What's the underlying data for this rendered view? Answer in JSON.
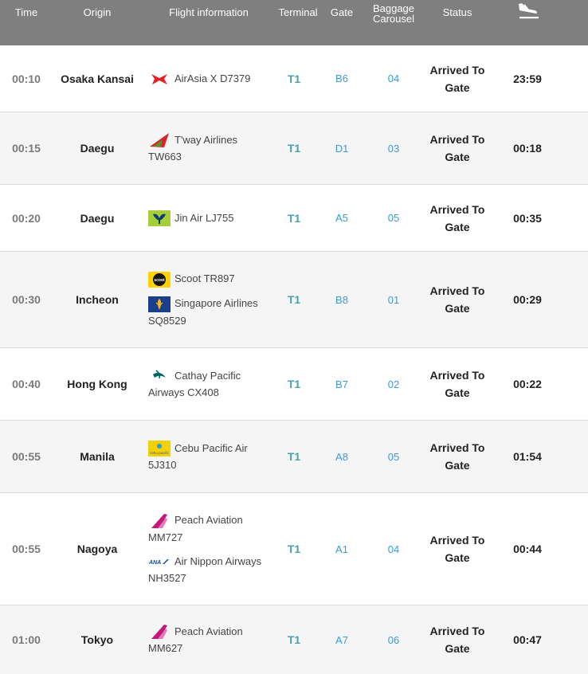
{
  "header": {
    "time": "Time",
    "origin": "Origin",
    "flight_info": "Flight information",
    "terminal": "Terminal",
    "gate": "Gate",
    "baggage_line1": "Baggage",
    "baggage_line2": "Carousel",
    "status": "Status",
    "arrival_icon": "plane-landing-icon"
  },
  "rows": [
    {
      "time": "00:10",
      "origin": "Osaka Kansai",
      "flights": [
        {
          "logo": "airasia-logo",
          "line1": "AirAsia X D7379",
          "line2": ""
        }
      ],
      "terminal": "T1",
      "gate": "B6",
      "carousel": "04",
      "status_line1": "Arrived To",
      "status_line2": "Gate",
      "actual": "23:59"
    },
    {
      "time": "00:15",
      "origin": "Daegu",
      "flights": [
        {
          "logo": "tway-logo",
          "line1": "T'way Airlines",
          "line2": "TW663"
        }
      ],
      "terminal": "T1",
      "gate": "D1",
      "carousel": "03",
      "status_line1": "Arrived To",
      "status_line2": "Gate",
      "actual": "00:18"
    },
    {
      "time": "00:20",
      "origin": "Daegu",
      "flights": [
        {
          "logo": "jinair-logo",
          "line1": "Jin Air LJ755",
          "line2": ""
        }
      ],
      "terminal": "T1",
      "gate": "A5",
      "carousel": "05",
      "status_line1": "Arrived To",
      "status_line2": "Gate",
      "actual": "00:35"
    },
    {
      "time": "00:30",
      "origin": "Incheon",
      "flights": [
        {
          "logo": "scoot-logo",
          "line1": "Scoot TR897",
          "line2": ""
        },
        {
          "logo": "singapore-airlines-logo",
          "line1": "Singapore Airlines",
          "line2": "SQ8529"
        }
      ],
      "terminal": "T1",
      "gate": "B8",
      "carousel": "01",
      "status_line1": "Arrived To",
      "status_line2": "Gate",
      "actual": "00:29"
    },
    {
      "time": "00:40",
      "origin": "Hong Kong",
      "flights": [
        {
          "logo": "cathay-pacific-logo",
          "line1": "Cathay Pacific",
          "line2": "Airways CX408"
        }
      ],
      "terminal": "T1",
      "gate": "B7",
      "carousel": "02",
      "status_line1": "Arrived To",
      "status_line2": "Gate",
      "actual": "00:22"
    },
    {
      "time": "00:55",
      "origin": "Manila",
      "flights": [
        {
          "logo": "cebu-pacific-logo",
          "line1": "Cebu Pacific Air",
          "line2": "5J310"
        }
      ],
      "terminal": "T1",
      "gate": "A8",
      "carousel": "05",
      "status_line1": "Arrived To",
      "status_line2": "Gate",
      "actual": "01:54"
    },
    {
      "time": "00:55",
      "origin": "Nagoya",
      "flights": [
        {
          "logo": "peach-logo",
          "line1": "Peach Aviation",
          "line2": "MM727"
        },
        {
          "logo": "ana-logo",
          "line1": "Air Nippon Airways",
          "line2": "NH3527"
        }
      ],
      "terminal": "T1",
      "gate": "A1",
      "carousel": "04",
      "status_line1": "Arrived To",
      "status_line2": "Gate",
      "actual": "00:44"
    },
    {
      "time": "01:00",
      "origin": "Tokyo",
      "flights": [
        {
          "logo": "peach-logo",
          "line1": "Peach Aviation",
          "line2": "MM627"
        }
      ],
      "terminal": "T1",
      "gate": "A7",
      "carousel": "06",
      "status_line1": "Arrived To",
      "status_line2": "Gate",
      "actual": "00:47"
    }
  ],
  "logo_text": {
    "scoot": "scoot",
    "cebu": "cebu pacific",
    "ana": "ANA"
  },
  "colors": {
    "header_bg": "#7f7f7f",
    "terminal": "#4aa3a3",
    "gate": "#3a9bd5",
    "airasia": "#e31e24",
    "tway": "#d7232a",
    "jinair": "#a6ce39",
    "peach": "#c2187a",
    "singapore": "#1b3f8b",
    "cathay": "#006564",
    "cebu": "#f4d000"
  }
}
